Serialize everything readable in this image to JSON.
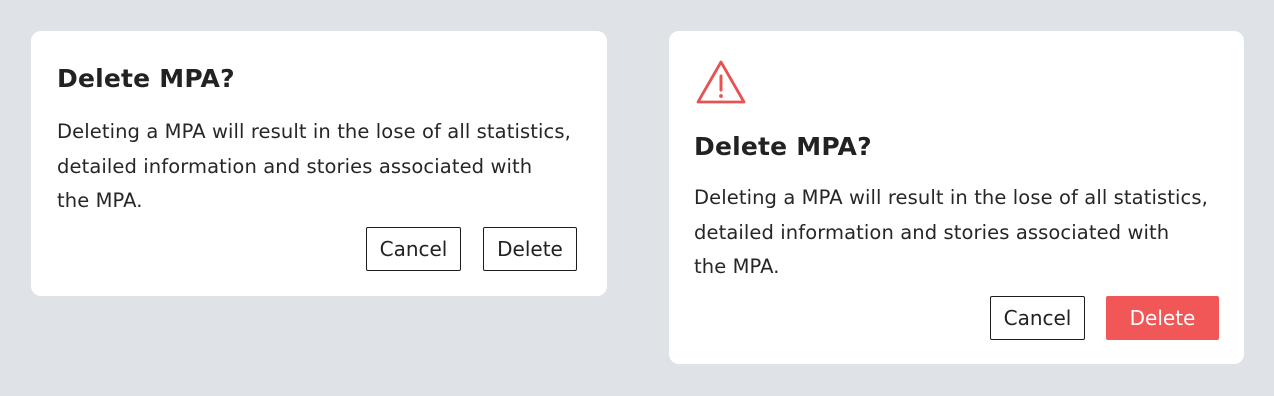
{
  "dialogs": [
    {
      "title": "Delete MPA?",
      "message_lines": [
        "Deleting a MPA will result in the lose of all statistics,",
        "detailed information and stories associated with",
        "the MPA."
      ],
      "cancel_label": "Cancel",
      "delete_label": "Delete",
      "delete_style": "outline"
    },
    {
      "icon": "warning-triangle-icon",
      "title": "Delete MPA?",
      "message_lines": [
        "Deleting a MPA will result in the lose of all statistics,",
        "detailed information and stories associated with",
        "the MPA."
      ],
      "cancel_label": "Cancel",
      "delete_label": "Delete",
      "delete_style": "danger"
    }
  ],
  "colors": {
    "background": "#dfe2e6",
    "surface": "#ffffff",
    "text": "#222222",
    "danger": "#f25757",
    "warning_icon": "#e55353"
  }
}
